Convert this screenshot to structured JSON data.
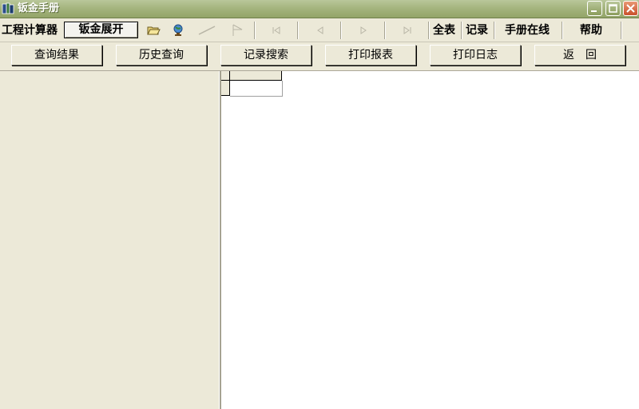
{
  "window": {
    "title": "钣金手册",
    "controls": [
      "minimize",
      "maximize",
      "close"
    ]
  },
  "toolbar1": {
    "calculator_label": "工程计算器",
    "unfold_label": "钣金展开",
    "icons": [
      "folder-open-icon",
      "globe-icon",
      "line-icon",
      "flag-icon",
      "first-record-icon",
      "prev-record-icon",
      "next-record-icon",
      "last-record-icon"
    ],
    "full_table_label": "全表",
    "record_label": "记录",
    "online_label": "手册在线",
    "help_label": "帮助"
  },
  "toolbar2": {
    "buttons": [
      {
        "label": "查询结果"
      },
      {
        "label": "历史查询"
      },
      {
        "label": "记录搜索"
      },
      {
        "label": "打印报表"
      },
      {
        "label": "打印日志"
      },
      {
        "label": "返　回"
      }
    ]
  },
  "colors": {
    "titlebar": "#a5b57f",
    "face": "#ece9d8",
    "grid_bg": "#ffffff"
  }
}
